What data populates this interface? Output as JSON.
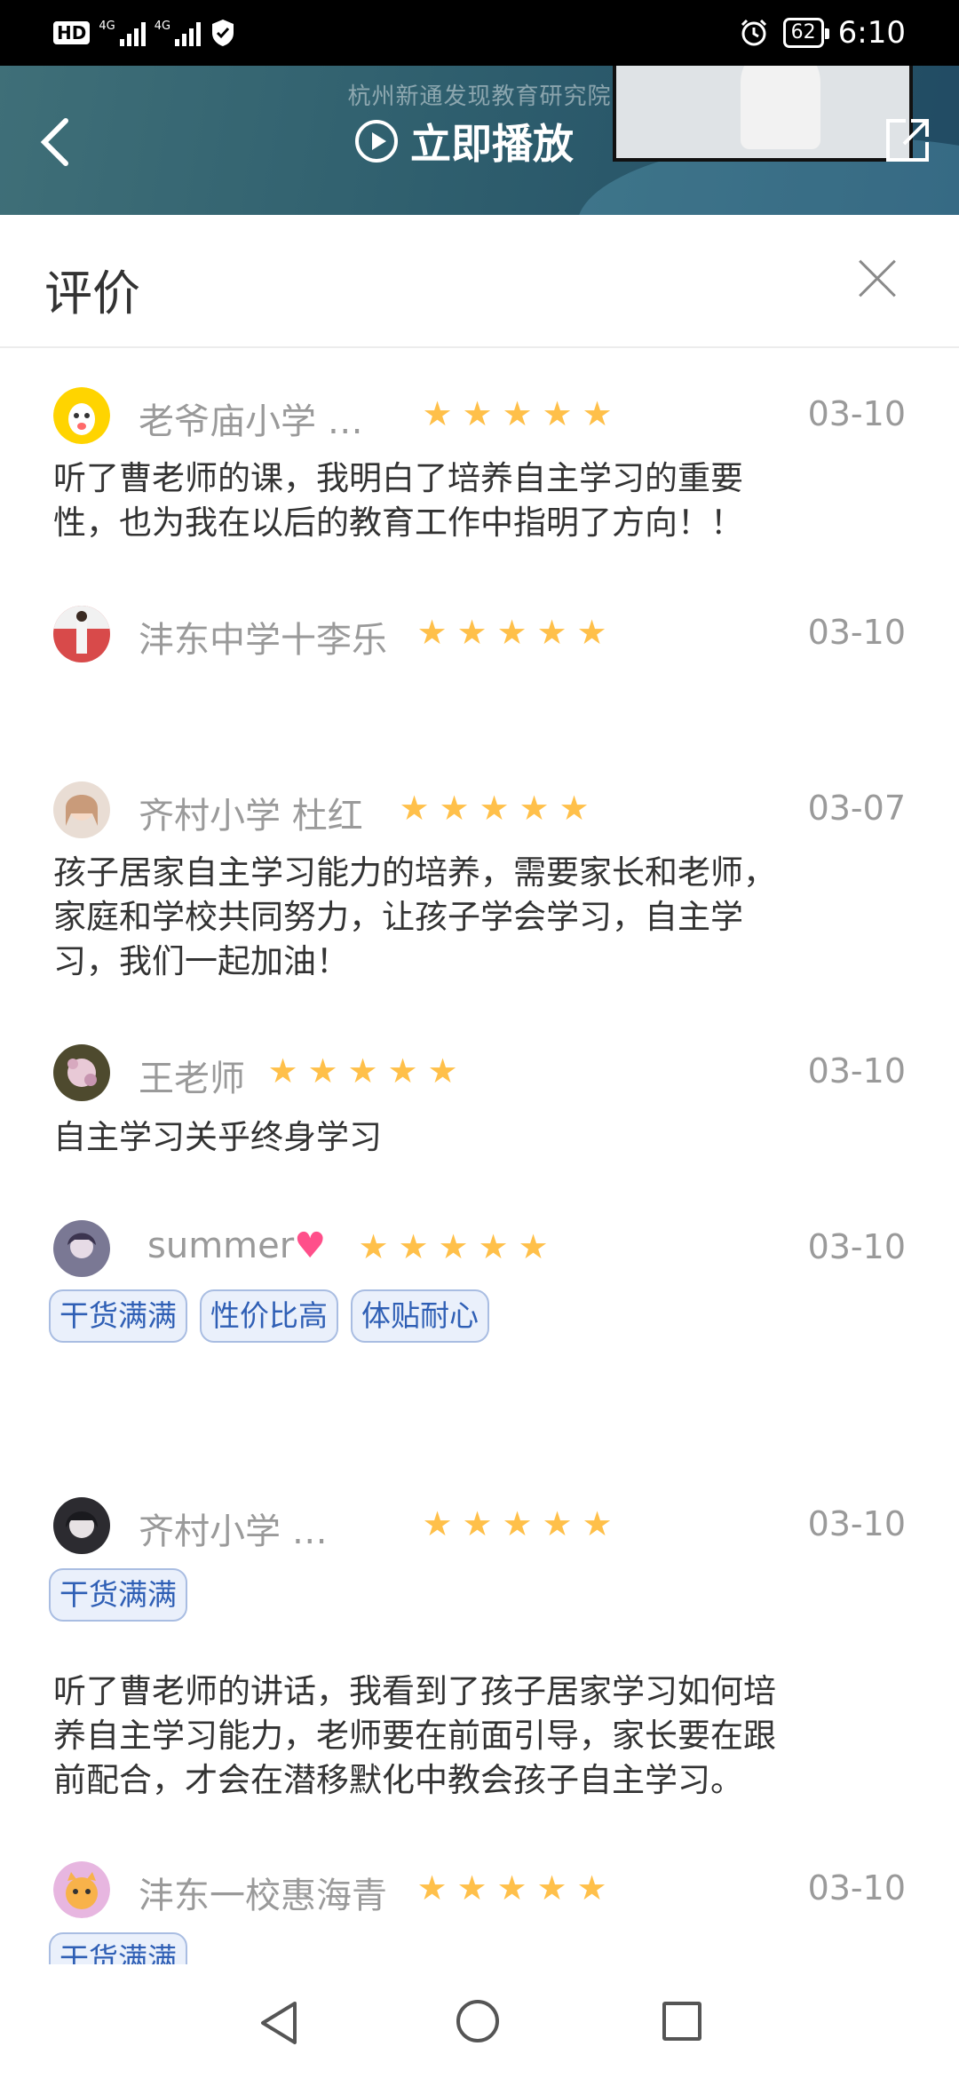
{
  "status_bar": {
    "network_1": "4G",
    "network_2": "4G",
    "battery": "62",
    "time": "6:10"
  },
  "video_header": {
    "subtitle": "杭州新通发现教育研究院",
    "play_label": "立即播放"
  },
  "sheet": {
    "title": "评价"
  },
  "colors": {
    "star": "#ffc04a",
    "tag_text": "#2f5fb5",
    "tag_bg": "#eaf0fb",
    "muted": "#9a9a9a"
  },
  "reviews": [
    {
      "name": "老爷庙小学 …",
      "rating": 5,
      "date": "03-10",
      "text": [
        "听了曹老师的课，我明白了培养自主学习的重要",
        "性，也为我在以后的教育工作中指明了方向！！"
      ]
    },
    {
      "name": "沣东中学十李乐",
      "rating": 5,
      "date": "03-10"
    },
    {
      "name": "齐村小学 杜红",
      "rating": 5,
      "date": "03-07",
      "text": [
        "孩子居家自主学习能力的培养，需要家长和老师，",
        "家庭和学校共同努力，让孩子学会学习，自主学",
        "习，我们一起加油！"
      ]
    },
    {
      "name": "王老师",
      "rating": 5,
      "date": "03-10",
      "text": [
        "自主学习关乎终身学习"
      ]
    },
    {
      "name": "summer",
      "rating": 5,
      "date": "03-10",
      "tags": [
        "干货满满",
        "性价比高",
        "体贴耐心"
      ]
    },
    {
      "name": "齐村小学 …",
      "rating": 5,
      "date": "03-10",
      "tags": [
        "干货满满"
      ],
      "text": [
        "听了曹老师的讲话，我看到了孩子居家学习如何培",
        "养自主学习能力，老师要在前面引导，家长要在跟",
        "前配合，才会在潜移默化中教会孩子自主学习。"
      ]
    },
    {
      "name": "沣东一校惠海青",
      "rating": 5,
      "date": "03-10",
      "tags": [
        "干货满满"
      ]
    }
  ]
}
